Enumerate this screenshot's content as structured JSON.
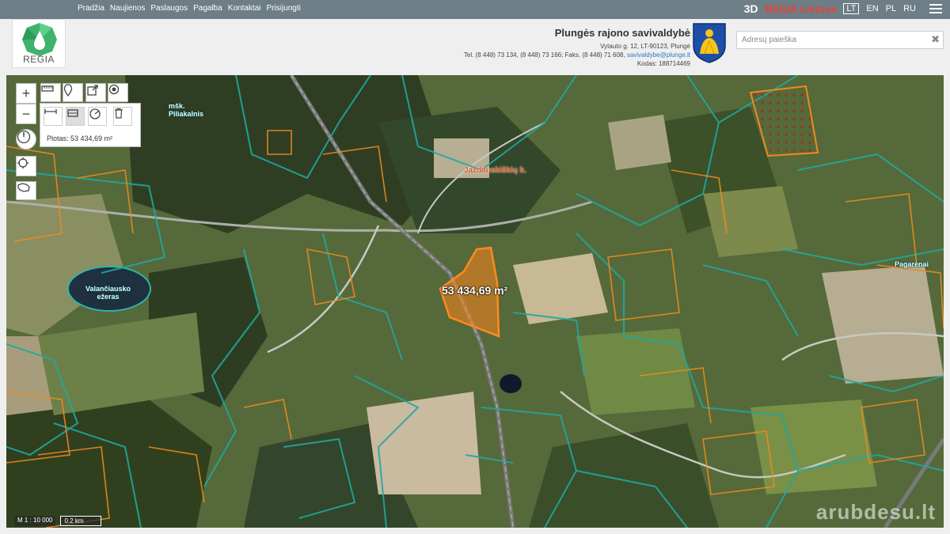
{
  "topbar": {
    "nav": [
      "Pradžia",
      "Naujienos",
      "Paslaugos",
      "Pagalba",
      "Kontaktai",
      "Prisijungti"
    ],
    "mode_3d": "3D",
    "regia": "REGIA Lietuva",
    "languages": [
      "LT",
      "EN",
      "PL",
      "RU"
    ],
    "active_language": "LT"
  },
  "header": {
    "logo_text": "REGIA",
    "municipality": "Plungės rajono savivaldybė",
    "address": "Vytauto g. 12, LT-90123, Plungė",
    "phones": "Tel. (8 448) 73 134, (8 448) 73 166; Faks. (8 448) 71 608,",
    "email": "savivaldybe@plunge.lt",
    "code": "Kodas: 188714469",
    "search_placeholder": "Adresų paieška"
  },
  "map": {
    "area_label": "53 434,69 m²",
    "measure_text": "Plotas: 53 434,69 m²",
    "places": {
      "lake1": "Valančiausko",
      "lake2": "ežeras",
      "village": "Jazdauskiškių k.",
      "forest": "mšk. Piliakalnis",
      "east": "Pagarėnai"
    },
    "scale_text": "M 1 : 10 000",
    "scale_bar": "0.2 km",
    "watermark": "arubdesu.lt"
  },
  "colors": {
    "topbar": "#6d7e86",
    "parcel_teal": "#1fa8a0",
    "parcel_orange": "#f08a1e",
    "accent_red": "#e8413b"
  }
}
